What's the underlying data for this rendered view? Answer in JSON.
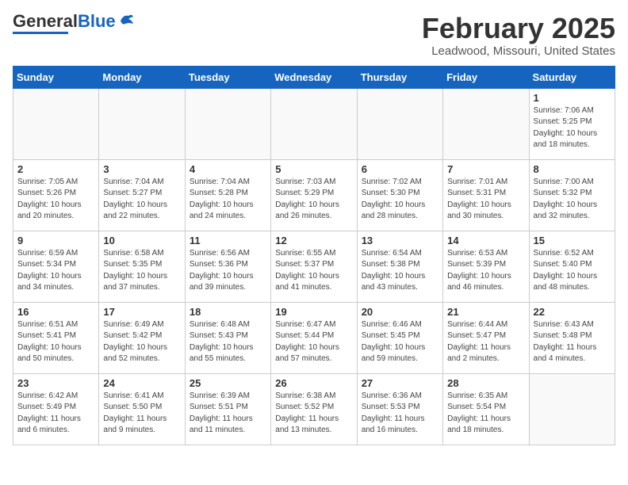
{
  "header": {
    "logo_general": "General",
    "logo_blue": "Blue",
    "month": "February 2025",
    "location": "Leadwood, Missouri, United States"
  },
  "days_of_week": [
    "Sunday",
    "Monday",
    "Tuesday",
    "Wednesday",
    "Thursday",
    "Friday",
    "Saturday"
  ],
  "weeks": [
    [
      {
        "day": "",
        "info": ""
      },
      {
        "day": "",
        "info": ""
      },
      {
        "day": "",
        "info": ""
      },
      {
        "day": "",
        "info": ""
      },
      {
        "day": "",
        "info": ""
      },
      {
        "day": "",
        "info": ""
      },
      {
        "day": "1",
        "info": "Sunrise: 7:06 AM\nSunset: 5:25 PM\nDaylight: 10 hours and 18 minutes."
      }
    ],
    [
      {
        "day": "2",
        "info": "Sunrise: 7:05 AM\nSunset: 5:26 PM\nDaylight: 10 hours and 20 minutes."
      },
      {
        "day": "3",
        "info": "Sunrise: 7:04 AM\nSunset: 5:27 PM\nDaylight: 10 hours and 22 minutes."
      },
      {
        "day": "4",
        "info": "Sunrise: 7:04 AM\nSunset: 5:28 PM\nDaylight: 10 hours and 24 minutes."
      },
      {
        "day": "5",
        "info": "Sunrise: 7:03 AM\nSunset: 5:29 PM\nDaylight: 10 hours and 26 minutes."
      },
      {
        "day": "6",
        "info": "Sunrise: 7:02 AM\nSunset: 5:30 PM\nDaylight: 10 hours and 28 minutes."
      },
      {
        "day": "7",
        "info": "Sunrise: 7:01 AM\nSunset: 5:31 PM\nDaylight: 10 hours and 30 minutes."
      },
      {
        "day": "8",
        "info": "Sunrise: 7:00 AM\nSunset: 5:32 PM\nDaylight: 10 hours and 32 minutes."
      }
    ],
    [
      {
        "day": "9",
        "info": "Sunrise: 6:59 AM\nSunset: 5:34 PM\nDaylight: 10 hours and 34 minutes."
      },
      {
        "day": "10",
        "info": "Sunrise: 6:58 AM\nSunset: 5:35 PM\nDaylight: 10 hours and 37 minutes."
      },
      {
        "day": "11",
        "info": "Sunrise: 6:56 AM\nSunset: 5:36 PM\nDaylight: 10 hours and 39 minutes."
      },
      {
        "day": "12",
        "info": "Sunrise: 6:55 AM\nSunset: 5:37 PM\nDaylight: 10 hours and 41 minutes."
      },
      {
        "day": "13",
        "info": "Sunrise: 6:54 AM\nSunset: 5:38 PM\nDaylight: 10 hours and 43 minutes."
      },
      {
        "day": "14",
        "info": "Sunrise: 6:53 AM\nSunset: 5:39 PM\nDaylight: 10 hours and 46 minutes."
      },
      {
        "day": "15",
        "info": "Sunrise: 6:52 AM\nSunset: 5:40 PM\nDaylight: 10 hours and 48 minutes."
      }
    ],
    [
      {
        "day": "16",
        "info": "Sunrise: 6:51 AM\nSunset: 5:41 PM\nDaylight: 10 hours and 50 minutes."
      },
      {
        "day": "17",
        "info": "Sunrise: 6:49 AM\nSunset: 5:42 PM\nDaylight: 10 hours and 52 minutes."
      },
      {
        "day": "18",
        "info": "Sunrise: 6:48 AM\nSunset: 5:43 PM\nDaylight: 10 hours and 55 minutes."
      },
      {
        "day": "19",
        "info": "Sunrise: 6:47 AM\nSunset: 5:44 PM\nDaylight: 10 hours and 57 minutes."
      },
      {
        "day": "20",
        "info": "Sunrise: 6:46 AM\nSunset: 5:45 PM\nDaylight: 10 hours and 59 minutes."
      },
      {
        "day": "21",
        "info": "Sunrise: 6:44 AM\nSunset: 5:47 PM\nDaylight: 11 hours and 2 minutes."
      },
      {
        "day": "22",
        "info": "Sunrise: 6:43 AM\nSunset: 5:48 PM\nDaylight: 11 hours and 4 minutes."
      }
    ],
    [
      {
        "day": "23",
        "info": "Sunrise: 6:42 AM\nSunset: 5:49 PM\nDaylight: 11 hours and 6 minutes."
      },
      {
        "day": "24",
        "info": "Sunrise: 6:41 AM\nSunset: 5:50 PM\nDaylight: 11 hours and 9 minutes."
      },
      {
        "day": "25",
        "info": "Sunrise: 6:39 AM\nSunset: 5:51 PM\nDaylight: 11 hours and 11 minutes."
      },
      {
        "day": "26",
        "info": "Sunrise: 6:38 AM\nSunset: 5:52 PM\nDaylight: 11 hours and 13 minutes."
      },
      {
        "day": "27",
        "info": "Sunrise: 6:36 AM\nSunset: 5:53 PM\nDaylight: 11 hours and 16 minutes."
      },
      {
        "day": "28",
        "info": "Sunrise: 6:35 AM\nSunset: 5:54 PM\nDaylight: 11 hours and 18 minutes."
      },
      {
        "day": "",
        "info": ""
      }
    ]
  ]
}
